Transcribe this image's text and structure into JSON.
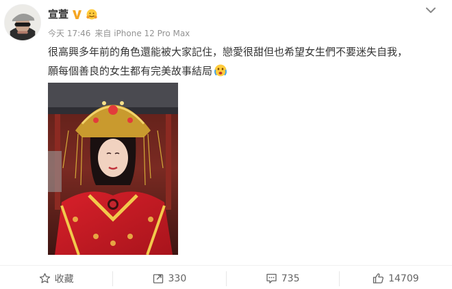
{
  "post": {
    "username": "宣萱",
    "verified_icon": "verified-v-badge-icon",
    "timestamp": "今天 17:46",
    "source": "来自 iPhone 12 Pro Max",
    "text_line1": "很高興多年前的角色還能被大家記住，戀愛很甜但也希望女生們不要迷失自我，",
    "text_line2": "願每個善良的女生都有完美故事結局",
    "image_description_icon": "photo-icon"
  },
  "actions": {
    "favorite_label": "收藏",
    "repost_count": "330",
    "comment_count": "735",
    "like_count": "14709"
  },
  "colors": {
    "accent": "#f5a623",
    "text": "#333333",
    "meta": "#939393",
    "action": "#636363"
  }
}
